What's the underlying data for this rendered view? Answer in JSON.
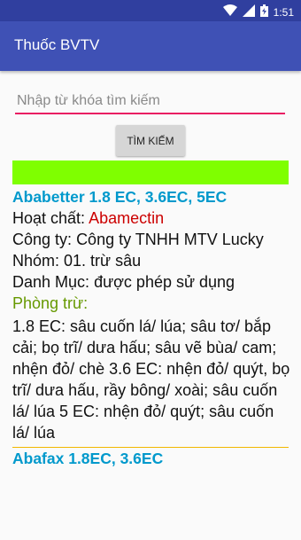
{
  "status_bar": {
    "time": "1:51"
  },
  "app_bar": {
    "title": "Thuốc BVTV"
  },
  "search": {
    "placeholder": "Nhập từ khóa tìm kiếm",
    "button_label": "TÌM KIẾM"
  },
  "colors": {
    "primary": "#3f51b5",
    "primary_dark": "#303f9f",
    "accent": "#e91e63",
    "highlight_bar": "#7fff00",
    "item_title": "#0099cc",
    "active_ingredient": "#cc0000",
    "section_label": "#669900"
  },
  "results": [
    {
      "title": "Ababetter 1.8 EC, 3.6EC, 5EC",
      "active_label": "Hoạt chất:",
      "active_value": "Abamectin",
      "company_label": "Công ty:",
      "company_value": "Công ty TNHH MTV Lucky",
      "group_label": "Nhóm:",
      "group_value": "01. trừ sâu",
      "category_label": "Danh Mục:",
      "category_value": "được phép sử dụng",
      "pest_label": "Phòng trừ:",
      "pest_text": "1.8 EC: sâu cuốn lá/ lúa; sâu tơ/ bắp cải; bọ trĩ/ dưa hấu; sâu vẽ bùa/ cam; nhện đỏ/ chè 3.6 EC: nhện đỏ/ quýt, bọ trĩ/ dưa hấu, rầy bông/ xoài; sâu cuốn lá/ lúa 5 EC: nhện đỏ/ quýt; sâu cuốn lá/ lúa"
    },
    {
      "title": "Abafax 1.8EC, 3.6EC"
    }
  ]
}
